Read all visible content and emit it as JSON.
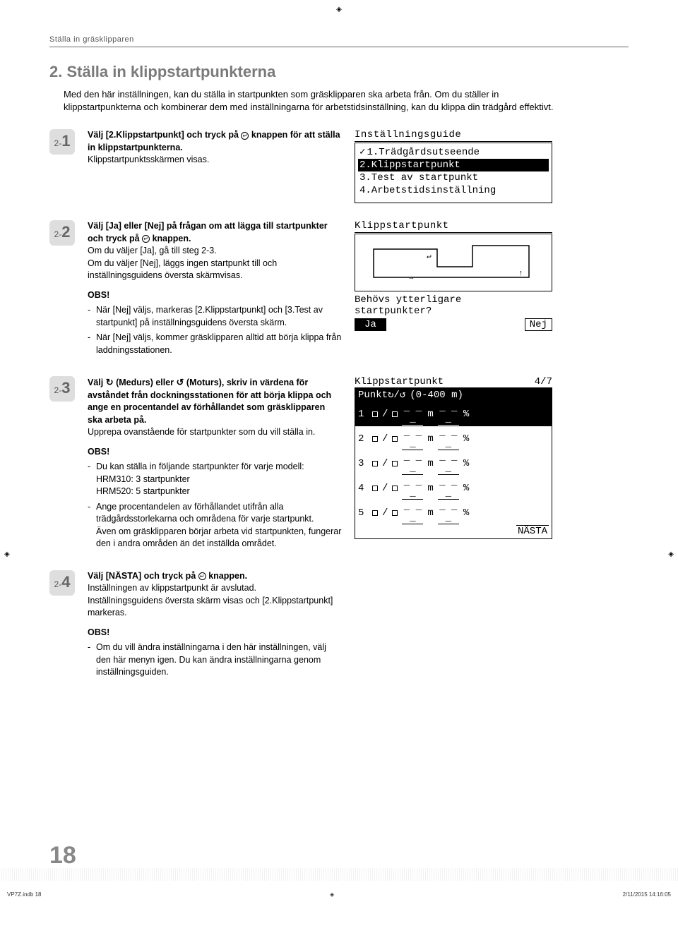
{
  "header": {
    "breadcrumb": "Ställa in gräsklipparen"
  },
  "title": "2. Ställa in klippstartpunkterna",
  "intro": "Med den här inställningen, kan du ställa in startpunkten som gräsklipparen ska arbeta från. Om du ställer in klippstartpunkterna och kombinerar dem med inställningarna för arbetstidsinställning, kan du klippa din trädgård effektivt.",
  "steps": {
    "s1": {
      "pre": "2-",
      "num": "1",
      "boldA": "Välj [2.Klippstartpunkt] och tryck på ",
      "boldB": " knappen för att ställa in klippstartpunkterna.",
      "sub": "Klippstartpunktsskärmen visas."
    },
    "s2": {
      "pre": "2-",
      "num": "2",
      "boldA": "Välj [Ja] eller [Nej] på frågan om att lägga till startpunkter och tryck på ",
      "boldB": " knappen.",
      "sub1": "Om du väljer [Ja], gå till steg 2-3.",
      "sub2": "Om du väljer [Nej], läggs ingen startpunkt till och inställningsguidens översta skärmvisas.",
      "obs": "OBS!",
      "li1": "När [Nej] väljs, markeras [2.Klippstartpunkt] och [3.Test av startpunkt] på inställningsguidens översta skärm.",
      "li2": "När [Nej] väljs, kommer gräsklipparen alltid att börja klippa från laddningsstationen."
    },
    "s3": {
      "pre": "2-",
      "num": "3",
      "boldA": "Välj ",
      "cw": "↻",
      "boldB": " (Medurs) eller ",
      "ccw": "↺",
      "boldC": " (Moturs), skriv in värdena för avståndet från dockningsstationen för att börja klippa och ange en procentandel av förhållandet som gräsklipparen ska arbeta på.",
      "sub": "Upprepa ovanstående för startpunkter som du vill ställa in.",
      "obs": "OBS!",
      "li1": "Du kan ställa in följande startpunkter för varje modell:",
      "li1a": "HRM310: 3 startpunkter",
      "li1b": "HRM520: 5 startpunkter",
      "li2": "Ange procentandelen av förhållandet utifrån alla trädgårdsstorlekarna och områdena för varje startpunkt.",
      "li2a": "Även om gräsklipparen börjar arbeta vid startpunkten, fungerar den i andra områden än det inställda området."
    },
    "s4": {
      "pre": "2-",
      "num": "4",
      "boldA": "Välj [NÄSTA] och tryck på ",
      "boldB": " knappen.",
      "sub1": "Inställningen av klippstartpunkt är avslutad.",
      "sub2": "Inställningsguidens översta skärm visas och [2.Klippstartpunkt] markeras.",
      "obs": "OBS!",
      "li1": "Om du vill ändra inställningarna i den här inställningen, välj den här menyn igen. Du kan ändra inställningarna genom inställningsguiden."
    }
  },
  "screen1": {
    "title": "Inställningsguide",
    "i1": "1.Trädgårdsutseende",
    "i2": "2.Klippstartpunkt",
    "i3": "3.Test av startpunkt",
    "i4": "4.Arbetstidsinställning"
  },
  "screen2": {
    "title": "Klippstartpunkt",
    "q1": "Behövs ytterligare",
    "q2": "startpunkter?",
    "ja": "Ja",
    "nej": "Nej"
  },
  "screen3": {
    "title": "Klippstartpunkt",
    "count": "4/7",
    "hdrA": "Punkt↻/↺",
    "hdrB": "(0-400 m)",
    "rows": [
      {
        "n": "1",
        "m": "m",
        "p": "%"
      },
      {
        "n": "2",
        "m": "m",
        "p": "%"
      },
      {
        "n": "3",
        "m": "m",
        "p": "%"
      },
      {
        "n": "4",
        "m": "m",
        "p": "%"
      },
      {
        "n": "5",
        "m": "m",
        "p": "%"
      }
    ],
    "next": "NÄSTA"
  },
  "pageNumber": "18",
  "footer": {
    "left": "VP7Z.indb   18",
    "right": "2/11/2015   14:16:05"
  }
}
